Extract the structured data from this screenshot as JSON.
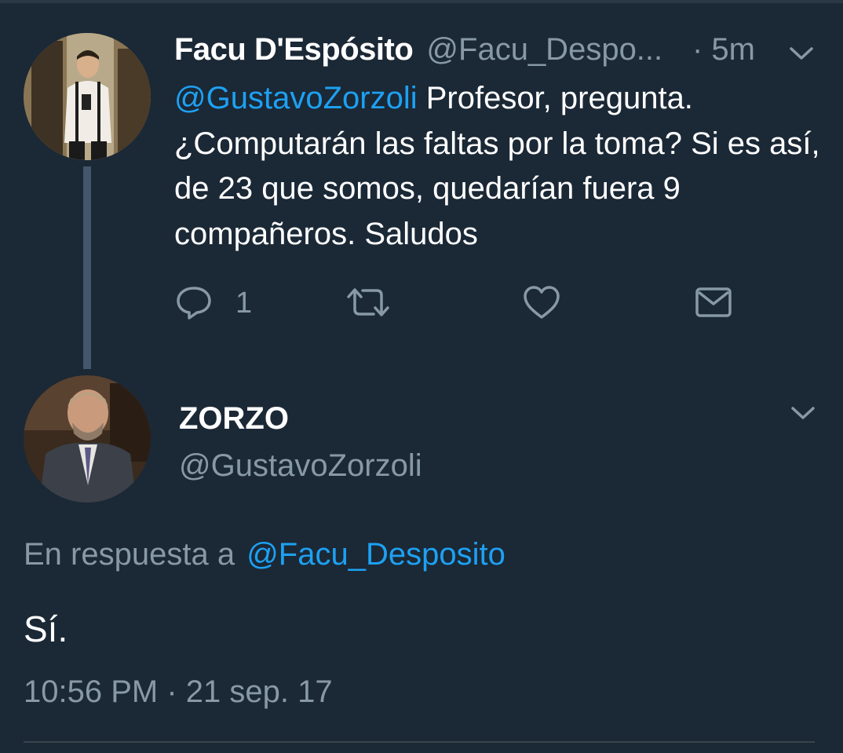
{
  "tweet1": {
    "author_name": "Facu D'Espósito",
    "author_handle": "@Facu_Despo...",
    "time": "· 5m",
    "mention": "@GustavoZorzoli",
    "text": " Profesor, pregunta. ¿Computarán las faltas por la toma? Si es así, de 23 que somos, quedarían fuera 9 compañeros. Saludos",
    "reply_count": "1",
    "icons": {
      "reply": "reply-icon",
      "retweet": "retweet-icon",
      "like": "like-icon",
      "message": "envelope-icon",
      "more": "chevron-down-icon"
    }
  },
  "tweet2": {
    "author_name": "ZORZO",
    "author_handle": "@GustavoZorzoli",
    "reply_prefix": "En respuesta a",
    "reply_to": "@Facu_Desposito",
    "text": "Sí.",
    "date": "10:56 PM · 21 sep. 17"
  },
  "colors": {
    "background": "#1b2836",
    "text": "#ffffff",
    "muted": "#8899a6",
    "link": "#1da1f2",
    "thread_line": "#42576b"
  }
}
